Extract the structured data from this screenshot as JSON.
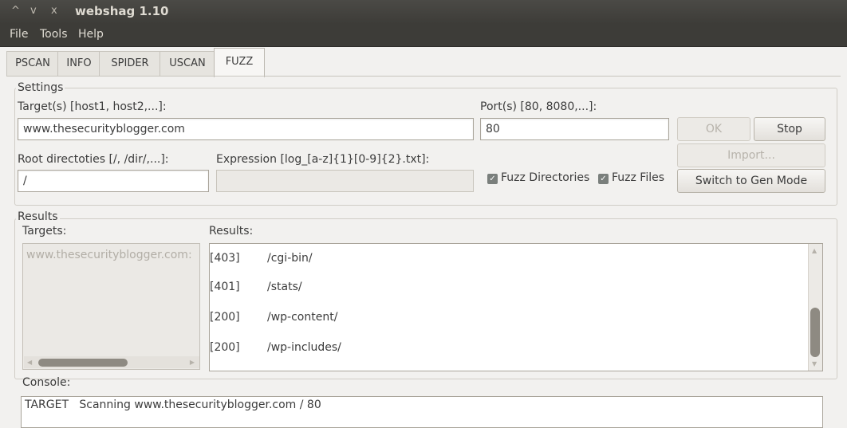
{
  "window": {
    "title": "webshag 1.10",
    "controls": [
      "^",
      "v",
      "x"
    ]
  },
  "menu": [
    "File",
    "Tools",
    "Help"
  ],
  "tabs": [
    "PSCAN",
    "INFO",
    "SPIDER",
    "USCAN",
    "FUZZ"
  ],
  "active_tab": "FUZZ",
  "settings": {
    "group_title": "Settings",
    "targets_label": "Target(s) [host1, host2,...]:",
    "targets_value": "www.thesecurityblogger.com",
    "ports_label": "Port(s) [80, 8080,...]:",
    "ports_value": "80",
    "root_label": "Root directoties [/, /dir/,...]:",
    "root_value": "/",
    "expression_label": "Expression [log_[a-z]{1}[0-9]{2}.txt]:",
    "expression_value": "",
    "fuzz_dirs_label": "Fuzz Directories",
    "fuzz_dirs_checked": true,
    "fuzz_files_label": "Fuzz Files",
    "fuzz_files_checked": true,
    "ok_label": "OK",
    "stop_label": "Stop",
    "import_label": "Import...",
    "switch_label": "Switch to Gen Mode"
  },
  "results": {
    "group_title": "Results",
    "targets_label": "Targets:",
    "targets": [
      "www.thesecurityblogger.com:"
    ],
    "results_label": "Results:",
    "rows": [
      {
        "code": "[403]",
        "path": "/cgi-bin/"
      },
      {
        "code": "[401]",
        "path": "/stats/"
      },
      {
        "code": "[200]",
        "path": "/wp-content/"
      },
      {
        "code": "[200]",
        "path": "/wp-includes/"
      }
    ]
  },
  "console": {
    "label": "Console:",
    "lines": [
      "TARGET   Scanning www.thesecurityblogger.com / 80"
    ]
  },
  "colors": {
    "titlebar": "#3d3c38",
    "window_bg": "#f2f1ef"
  }
}
